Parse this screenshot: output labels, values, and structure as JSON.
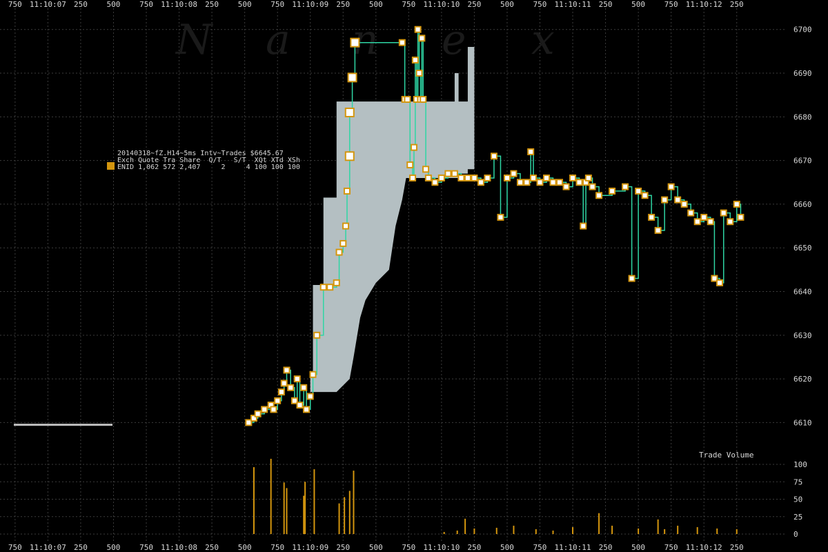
{
  "chart_data": [
    {
      "type": "line",
      "title": "",
      "legend": {
        "header": "20140318~fZ.H14~5ms Intv~Trades $6645.67",
        "columns": "Exch Quote Tra Share  Q/T   S/T  XQt XTd XSh",
        "rows": [
          "ENID 1,062 572 2,407     2     4 100 100 100"
        ],
        "swatch_color": "#d4960e",
        "position": "upper-left"
      },
      "watermark": [
        "N",
        "a",
        "n",
        "e",
        "x"
      ],
      "colors": {
        "trade_line": "#2ed6a4",
        "trade_marker_border": "#d4960e",
        "trade_marker_fill": "#ffffff",
        "quote_band": "#b4bfc2",
        "grid": "#3c3c3c",
        "volume_bar": "#d4960e",
        "reference_line": "#c0c0c0"
      },
      "x_tick_labels": [
        "750",
        "11:10:07",
        "250",
        "500",
        "750",
        "11:10:08",
        "250",
        "500",
        "750",
        "11:10:09",
        "250",
        "500",
        "750",
        "11:10:10",
        "250",
        "500",
        "750",
        "11:10:11",
        "250",
        "500",
        "750",
        "11:10:12",
        "250"
      ],
      "x_tick_values_sec": [
        6.75,
        7.0,
        7.25,
        7.5,
        7.75,
        8.0,
        8.25,
        8.5,
        8.75,
        9.0,
        9.25,
        9.5,
        9.75,
        10.0,
        10.25,
        10.5,
        10.75,
        11.0,
        11.25,
        11.5,
        11.75,
        12.0,
        12.25
      ],
      "x_range_sec": [
        6.635,
        12.63
      ],
      "y_tick_labels": [
        "6610",
        "6620",
        "6630",
        "6640",
        "6650",
        "6660",
        "6670",
        "6680",
        "6690",
        "6700"
      ],
      "y_range": [
        6605.8,
        6702.8
      ],
      "quote_band": [
        [
          9.0,
          6617,
          6621.5
        ],
        [
          9.02,
          6617,
          6621.5
        ],
        [
          9.02,
          6617,
          6641.5
        ],
        [
          9.1,
          6617,
          6641.5
        ],
        [
          9.1,
          6617,
          6661.5
        ],
        [
          9.2,
          6617,
          6661.5
        ],
        [
          9.2,
          6617,
          6683.5
        ],
        [
          9.3,
          6620,
          6683.5
        ],
        [
          9.33,
          6625,
          6683.5
        ],
        [
          9.38,
          6634,
          6683.5
        ],
        [
          9.42,
          6638,
          6683.5
        ],
        [
          9.5,
          6642,
          6683.5
        ],
        [
          9.6,
          6645,
          6683.5
        ],
        [
          9.65,
          6655,
          6683.5
        ],
        [
          9.7,
          6661,
          6683.5
        ],
        [
          9.73,
          6666,
          6683.5
        ],
        [
          10.05,
          6666,
          6683.5
        ],
        [
          10.1,
          6666,
          6683.5
        ],
        [
          10.1,
          6666,
          6690
        ],
        [
          10.13,
          6666,
          6690
        ],
        [
          10.13,
          6667,
          6683.5
        ],
        [
          10.2,
          6667,
          6683.5
        ],
        [
          10.2,
          6668,
          6696
        ],
        [
          10.25,
          6668,
          6696
        ],
        [
          10.25,
          6668,
          6668.5
        ]
      ],
      "series": [
        {
          "x": [
            8.53,
            8.57,
            8.6,
            8.65,
            8.7,
            8.72,
            8.75,
            8.78,
            8.8,
            8.82,
            8.85,
            8.88,
            8.9,
            8.92,
            8.95,
            8.97,
            9.0,
            9.02,
            9.05,
            9.1,
            9.15,
            9.2,
            9.22,
            9.25,
            9.27,
            9.28,
            9.3,
            9.3,
            9.32,
            9.34,
            9.7,
            9.72,
            9.74,
            9.76,
            9.78,
            9.79,
            9.8,
            9.81,
            9.82,
            9.83,
            9.84,
            9.85,
            9.86,
            9.88,
            9.9,
            9.95,
            10.0,
            10.05,
            10.1,
            10.15,
            10.2,
            10.25,
            10.3,
            10.35,
            10.4,
            10.45,
            10.5,
            10.55,
            10.6,
            10.65,
            10.68,
            10.7,
            10.75,
            10.8,
            10.85,
            10.9,
            10.95,
            11.0,
            11.05,
            11.08,
            11.1,
            11.12,
            11.15,
            11.2,
            11.3,
            11.4,
            11.45,
            11.5,
            11.55,
            11.6,
            11.65,
            11.7,
            11.75,
            11.8,
            11.85,
            11.9,
            11.95,
            12.0,
            12.05,
            12.08,
            12.12,
            12.15,
            12.2,
            12.25,
            12.28
          ],
          "y": [
            6610,
            6611,
            6612,
            6613,
            6614,
            6613,
            6615,
            6617,
            6619,
            6622,
            6618,
            6615,
            6620,
            6614,
            6618,
            6613,
            6616,
            6621,
            6630,
            6641,
            6641,
            6642,
            6649,
            6651,
            6655,
            6663,
            6671,
            6681,
            6689,
            6697,
            6697,
            6684,
            6684,
            6669,
            6666,
            6673,
            6693,
            6684,
            6700,
            6690,
            6684,
            6698,
            6684,
            6668,
            6666,
            6665,
            6666,
            6667,
            6667,
            6666,
            6666,
            6666,
            6665,
            6666,
            6671,
            6657,
            6666,
            6667,
            6665,
            6665,
            6672,
            6666,
            6665,
            6666,
            6665,
            6665,
            6664,
            6666,
            6665,
            6655,
            6665,
            6666,
            6664,
            6662,
            6663,
            6664,
            6643,
            6663,
            6662,
            6657,
            6654,
            6661,
            6664,
            6661,
            6660,
            6658,
            6656,
            6657,
            6656,
            6643,
            6642,
            6658,
            6656,
            6660,
            6657
          ]
        },
        {
          "type": "bar",
          "title": "Trade Volume",
          "y_tick_labels": [
            "0",
            "25",
            "50",
            "75",
            "100"
          ],
          "y_range": [
            0,
            100
          ],
          "x": [
            8.57,
            8.7,
            8.8,
            8.82,
            8.95,
            8.96,
            9.03,
            9.22,
            9.26,
            9.3,
            9.33,
            10.02,
            10.12,
            10.18,
            10.25,
            10.42,
            10.55,
            10.72,
            10.85,
            11.0,
            11.2,
            11.3,
            11.5,
            11.65,
            11.7,
            11.8,
            11.95,
            12.1,
            12.25
          ],
          "values": [
            96,
            108,
            74,
            66,
            55,
            75,
            93,
            44,
            53,
            62,
            91,
            3,
            5,
            22,
            8,
            9,
            12,
            7,
            5,
            10,
            30,
            12,
            8,
            21,
            7,
            12,
            10,
            8,
            7
          ]
        }
      ]
    }
  ]
}
